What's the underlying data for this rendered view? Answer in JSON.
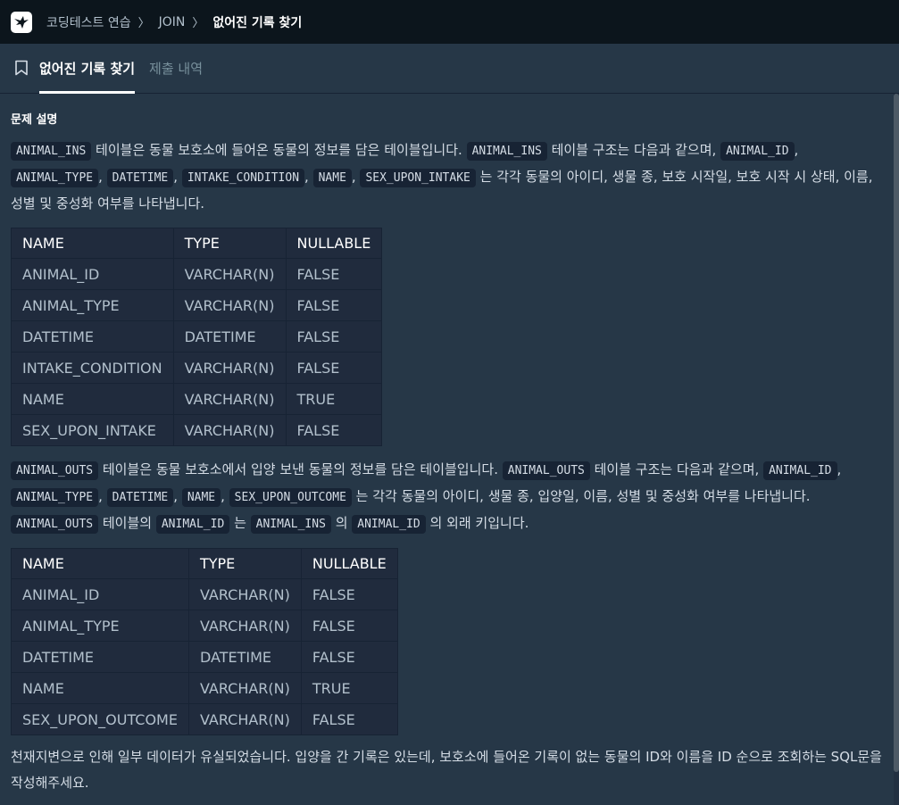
{
  "header": {
    "breadcrumb": [
      "코딩테스트 연습",
      "JOIN"
    ],
    "separator": "〉",
    "current": "없어진 기록 찾기"
  },
  "tabs": [
    {
      "label": "없어진 기록 찾기",
      "active": true,
      "icon": "bookmark-icon"
    },
    {
      "label": "제출 내역",
      "active": false
    }
  ],
  "problem": {
    "section_title": "문제 설명",
    "p1": {
      "c1": "ANIMAL_INS",
      "t1": " 테이블은 동물 보호소에 들어온 동물의 정보를 담은 테이블입니다. ",
      "c2": "ANIMAL_INS",
      "t2": " 테이블 구조는 다음과 같으며, ",
      "c3": "ANIMAL_ID",
      "t3": ", ",
      "c4": "ANIMAL_TYPE",
      "t4": ", ",
      "c5": "DATETIME",
      "t5": ", ",
      "c6": "INTAKE_CONDITION",
      "t6": ", ",
      "c7": "NAME",
      "t7": ", ",
      "c8": "SEX_UPON_INTAKE",
      "t8": " 는 각각 동물의 아이디, 생물 종, 보호 시작일, 보호 시작 시 상태, 이름, 성별 및 중성화 여부를 나타냅니다."
    },
    "table1": {
      "headers": [
        "NAME",
        "TYPE",
        "NULLABLE"
      ],
      "rows": [
        [
          "ANIMAL_ID",
          "VARCHAR(N)",
          "FALSE"
        ],
        [
          "ANIMAL_TYPE",
          "VARCHAR(N)",
          "FALSE"
        ],
        [
          "DATETIME",
          "DATETIME",
          "FALSE"
        ],
        [
          "INTAKE_CONDITION",
          "VARCHAR(N)",
          "FALSE"
        ],
        [
          "NAME",
          "VARCHAR(N)",
          "TRUE"
        ],
        [
          "SEX_UPON_INTAKE",
          "VARCHAR(N)",
          "FALSE"
        ]
      ]
    },
    "p2": {
      "c1": "ANIMAL_OUTS",
      "t1": " 테이블은 동물 보호소에서 입양 보낸 동물의 정보를 담은 테이블입니다. ",
      "c2": "ANIMAL_OUTS",
      "t2": " 테이블 구조는 다음과 같으며, ",
      "c3": "ANIMAL_ID",
      "t3": ", ",
      "c4": "ANIMAL_TYPE",
      "t4": ", ",
      "c5": "DATETIME",
      "t5": ", ",
      "c6": "NAME",
      "t6": ", ",
      "c7": "SEX_UPON_OUTCOME",
      "t7": " 는 각각 동물의 아이디, 생물 종, 입양일, 이름, 성별 및 중성화 여부를 나타냅니다. ",
      "c8": "ANIMAL_OUTS",
      "t8": " 테이블의 ",
      "c9": "ANIMAL_ID",
      "t9": " 는 ",
      "c10": "ANIMAL_INS",
      "t10": " 의 ",
      "c11": "ANIMAL_ID",
      "t11": " 의 외래 키입니다."
    },
    "table2": {
      "headers": [
        "NAME",
        "TYPE",
        "NULLABLE"
      ],
      "rows": [
        [
          "ANIMAL_ID",
          "VARCHAR(N)",
          "FALSE"
        ],
        [
          "ANIMAL_TYPE",
          "VARCHAR(N)",
          "FALSE"
        ],
        [
          "DATETIME",
          "DATETIME",
          "FALSE"
        ],
        [
          "NAME",
          "VARCHAR(N)",
          "TRUE"
        ],
        [
          "SEX_UPON_OUTCOME",
          "VARCHAR(N)",
          "FALSE"
        ]
      ]
    },
    "closing": "천재지변으로 인해 일부 데이터가 유실되었습니다. 입양을 간 기록은 있는데, 보호소에 들어온 기록이 없는 동물의 ID와 이름을 ID 순으로 조회하는 SQL문을 작성해주세요."
  }
}
